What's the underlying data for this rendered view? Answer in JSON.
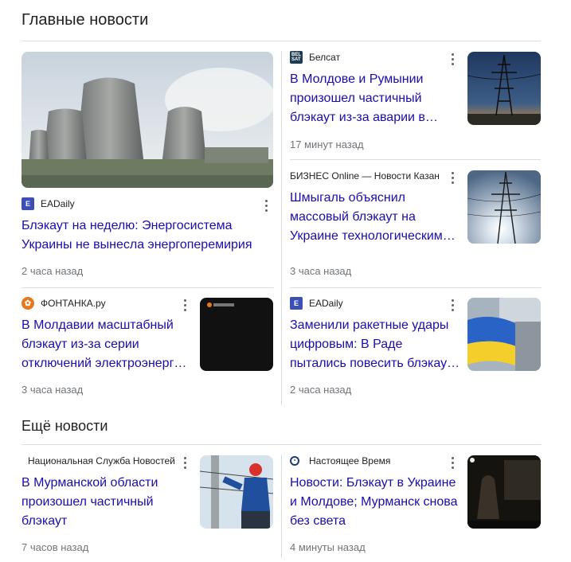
{
  "top": {
    "title": "Главные новости",
    "cards": [
      {
        "source": "EADaily",
        "headline": "Блэкаут на неделю: Энергосистема Украины не вынесла энергоперемирия",
        "time": "2 часа назад",
        "image": "cooling-towers-image"
      },
      {
        "source": "Белсат",
        "headline": "В Молдове и Румынии произошел частичный блэкаут из-за аварии в…",
        "time": "17 минут назад",
        "image": "power-line-sunset-image"
      },
      {
        "source": "БИЗНЕС Online — Новости Казан",
        "headline": "Шмыгаль объяснил массовый блэкаут на Украине технологическим…",
        "time": "3 часа назад",
        "image": "power-line-sun-image"
      },
      {
        "source": "ФОНТАНКА.ру",
        "headline": "В Молдавии масштабный блэкаут из-за серии отключений электроэнерг…",
        "time": "3 часа назад",
        "image": "fontanka-placeholder-image"
      },
      {
        "source": "EADaily",
        "headline": "Заменили ракетные удары цифровым: В Раде пытались повесить блэкау…",
        "time": "2 часа назад",
        "image": "ukraine-flag-image"
      }
    ]
  },
  "more": {
    "title": "Ещё новости",
    "cards": [
      {
        "source": "Национальная Служба Новостей",
        "headline": "В Мурманской области произошел частичный блэкаут",
        "time": "7 часов назад",
        "image": "electrician-pole-image"
      },
      {
        "source": "Настоящее Время",
        "headline": "Новости: Блэкаут в Украине и Молдове; Мурманск снова без света",
        "time": "4 минуты назад",
        "image": "dark-video-still-image"
      }
    ]
  },
  "colors": {
    "link": "#1a0dab",
    "time": "#70757a",
    "divider": "#dadce0",
    "eadaily_logo": "#3c4fb5",
    "fontanka_logo": "#e8761c"
  }
}
